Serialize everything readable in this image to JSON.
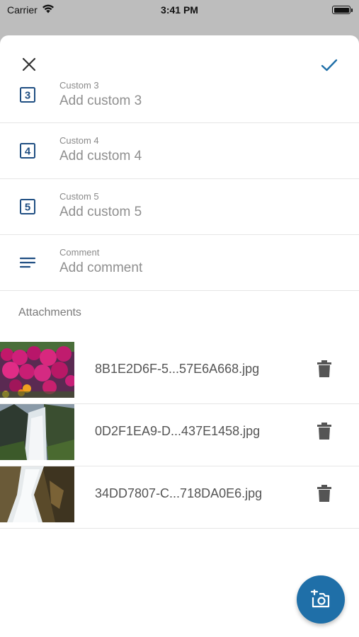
{
  "status_bar": {
    "carrier": "Carrier",
    "time": "3:41 PM",
    "battery_level": 1.0
  },
  "header": {
    "close_icon": "close-icon",
    "done_icon": "checkmark-icon",
    "accent_color": "#1f6fa8"
  },
  "fields": [
    {
      "label": "Custom 3",
      "placeholder": "Add custom 3",
      "icon": "number-3-icon",
      "icon_text": "3"
    },
    {
      "label": "Custom 4",
      "placeholder": "Add custom 4",
      "icon": "number-4-icon",
      "icon_text": "4"
    },
    {
      "label": "Custom 5",
      "placeholder": "Add custom 5",
      "icon": "number-5-icon",
      "icon_text": "5"
    },
    {
      "label": "Comment",
      "placeholder": "Add comment",
      "icon": "comment-lines-icon"
    }
  ],
  "attachments": {
    "title": "Attachments",
    "items": [
      {
        "name": "8B1E2D6F-5...57E6A668.jpg",
        "thumbnail": "flowers-photo"
      },
      {
        "name": "0D2F1EA9-D...437E1458.jpg",
        "thumbnail": "waterfall-photo"
      },
      {
        "name": "34DD7807-C...718DA0E6.jpg",
        "thumbnail": "cascade-photo"
      }
    ]
  },
  "fab": {
    "icon": "add-photo-icon",
    "color": "#1f6fa8"
  }
}
